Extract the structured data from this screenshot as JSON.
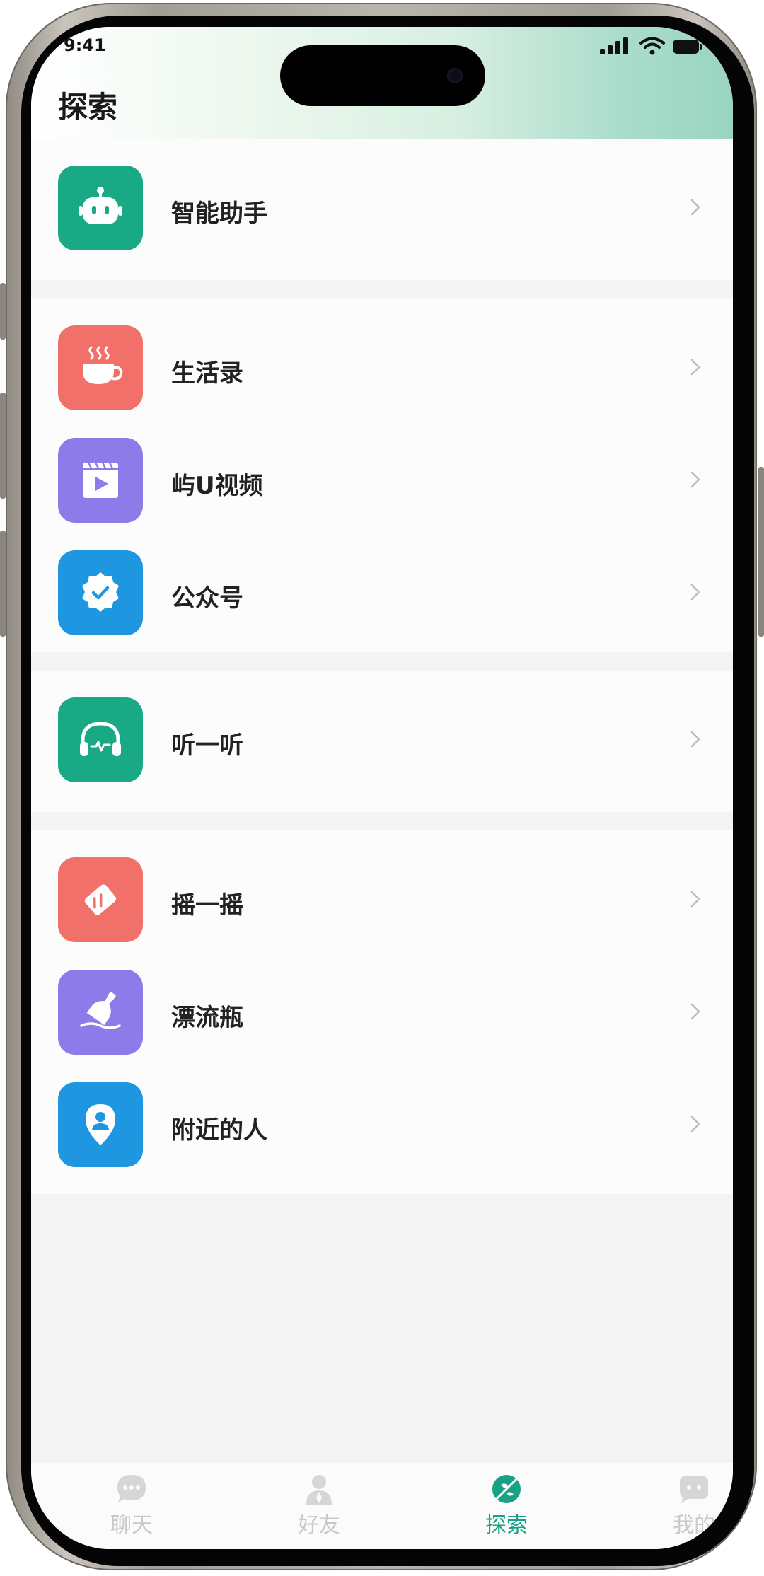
{
  "status": {
    "time": "9:41"
  },
  "header": {
    "title": "探索"
  },
  "sections": [
    [
      {
        "label": "智能助手",
        "icon": "robot-icon",
        "color": "#1aa985"
      }
    ],
    [
      {
        "label": "生活录",
        "icon": "coffee-cup-icon",
        "color": "#f2706a"
      },
      {
        "label": "屿U视频",
        "icon": "video-play-icon",
        "color": "#8c7be8"
      },
      {
        "label": "公众号",
        "icon": "verified-badge-icon",
        "color": "#1f96e0"
      }
    ],
    [
      {
        "label": "听一听",
        "icon": "headphones-icon",
        "color": "#1aa985"
      }
    ],
    [
      {
        "label": "摇一摇",
        "icon": "shake-phone-icon",
        "color": "#f2706a"
      },
      {
        "label": "漂流瓶",
        "icon": "drift-bottle-icon",
        "color": "#8c7be8"
      },
      {
        "label": "附近的人",
        "icon": "location-person-icon",
        "color": "#1f96e0"
      }
    ]
  ],
  "tabs": [
    {
      "label": "聊天",
      "icon": "chat-bubble-icon",
      "active": false
    },
    {
      "label": "好友",
      "icon": "friends-icon",
      "active": false
    },
    {
      "label": "探索",
      "icon": "explore-icon",
      "active": true
    },
    {
      "label": "我的",
      "icon": "profile-icon",
      "active": false
    }
  ],
  "colors": {
    "accent": "#19a185",
    "inactive_tab": "#c9c9c9",
    "label": "#222222"
  }
}
